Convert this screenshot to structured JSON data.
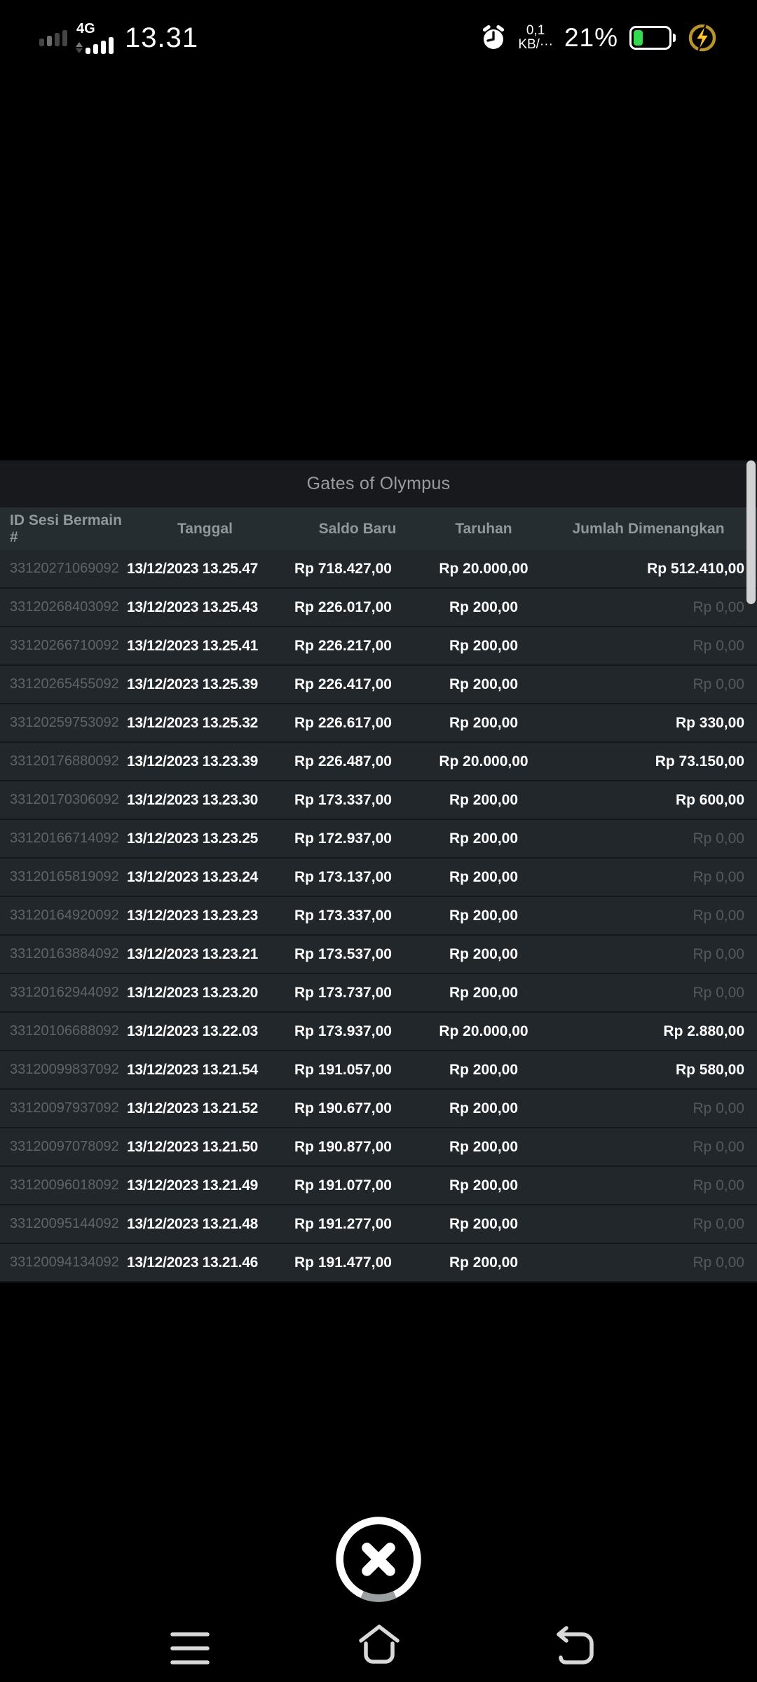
{
  "status_bar": {
    "time": "13.31",
    "network_label": "4G",
    "data_rate_value": "0,1",
    "data_rate_unit": "KB/···",
    "battery_percent": "21%",
    "battery_color": "#35d94e",
    "charging_icon_color": "#f0b928",
    "icons": [
      "sim1-signal-icon",
      "sim2-signal-4g-icon",
      "alarm-icon",
      "battery-icon",
      "charging-bolt-icon"
    ]
  },
  "table": {
    "title": "Gates of Olympus",
    "columns": [
      "ID Sesi Bermain #",
      "Tanggal",
      "Saldo Baru",
      "Taruhan",
      "Jumlah Dimenangkan"
    ],
    "rows": [
      {
        "id": "33120271069092",
        "date": "13/12/2023 13.25.47",
        "balance": "Rp 718.427,00",
        "bet": "Rp 20.000,00",
        "win": "Rp 512.410,00",
        "win_zero": false
      },
      {
        "id": "33120268403092",
        "date": "13/12/2023 13.25.43",
        "balance": "Rp 226.017,00",
        "bet": "Rp 200,00",
        "win": "Rp 0,00",
        "win_zero": true
      },
      {
        "id": "33120266710092",
        "date": "13/12/2023 13.25.41",
        "balance": "Rp 226.217,00",
        "bet": "Rp 200,00",
        "win": "Rp 0,00",
        "win_zero": true
      },
      {
        "id": "33120265455092",
        "date": "13/12/2023 13.25.39",
        "balance": "Rp 226.417,00",
        "bet": "Rp 200,00",
        "win": "Rp 0,00",
        "win_zero": true
      },
      {
        "id": "33120259753092",
        "date": "13/12/2023 13.25.32",
        "balance": "Rp 226.617,00",
        "bet": "Rp 200,00",
        "win": "Rp 330,00",
        "win_zero": false
      },
      {
        "id": "33120176880092",
        "date": "13/12/2023 13.23.39",
        "balance": "Rp 226.487,00",
        "bet": "Rp 20.000,00",
        "win": "Rp 73.150,00",
        "win_zero": false
      },
      {
        "id": "33120170306092",
        "date": "13/12/2023 13.23.30",
        "balance": "Rp 173.337,00",
        "bet": "Rp 200,00",
        "win": "Rp 600,00",
        "win_zero": false
      },
      {
        "id": "33120166714092",
        "date": "13/12/2023 13.23.25",
        "balance": "Rp 172.937,00",
        "bet": "Rp 200,00",
        "win": "Rp 0,00",
        "win_zero": true
      },
      {
        "id": "33120165819092",
        "date": "13/12/2023 13.23.24",
        "balance": "Rp 173.137,00",
        "bet": "Rp 200,00",
        "win": "Rp 0,00",
        "win_zero": true
      },
      {
        "id": "33120164920092",
        "date": "13/12/2023 13.23.23",
        "balance": "Rp 173.337,00",
        "bet": "Rp 200,00",
        "win": "Rp 0,00",
        "win_zero": true
      },
      {
        "id": "33120163884092",
        "date": "13/12/2023 13.23.21",
        "balance": "Rp 173.537,00",
        "bet": "Rp 200,00",
        "win": "Rp 0,00",
        "win_zero": true
      },
      {
        "id": "33120162944092",
        "date": "13/12/2023 13.23.20",
        "balance": "Rp 173.737,00",
        "bet": "Rp 200,00",
        "win": "Rp 0,00",
        "win_zero": true
      },
      {
        "id": "33120106688092",
        "date": "13/12/2023 13.22.03",
        "balance": "Rp 173.937,00",
        "bet": "Rp 20.000,00",
        "win": "Rp 2.880,00",
        "win_zero": false
      },
      {
        "id": "33120099837092",
        "date": "13/12/2023 13.21.54",
        "balance": "Rp 191.057,00",
        "bet": "Rp 200,00",
        "win": "Rp 580,00",
        "win_zero": false
      },
      {
        "id": "33120097937092",
        "date": "13/12/2023 13.21.52",
        "balance": "Rp 190.677,00",
        "bet": "Rp 200,00",
        "win": "Rp 0,00",
        "win_zero": true
      },
      {
        "id": "33120097078092",
        "date": "13/12/2023 13.21.50",
        "balance": "Rp 190.877,00",
        "bet": "Rp 200,00",
        "win": "Rp 0,00",
        "win_zero": true
      },
      {
        "id": "33120096018092",
        "date": "13/12/2023 13.21.49",
        "balance": "Rp 191.077,00",
        "bet": "Rp 200,00",
        "win": "Rp 0,00",
        "win_zero": true
      },
      {
        "id": "33120095144092",
        "date": "13/12/2023 13.21.48",
        "balance": "Rp 191.277,00",
        "bet": "Rp 200,00",
        "win": "Rp 0,00",
        "win_zero": true
      },
      {
        "id": "33120094134092",
        "date": "13/12/2023 13.21.46",
        "balance": "Rp 191.477,00",
        "bet": "Rp 200,00",
        "win": "Rp 0,00",
        "win_zero": true
      }
    ]
  },
  "controls": {
    "close_icon": "x-in-circle",
    "nav_icons": [
      "menu-icon",
      "home-icon",
      "back-icon"
    ]
  }
}
